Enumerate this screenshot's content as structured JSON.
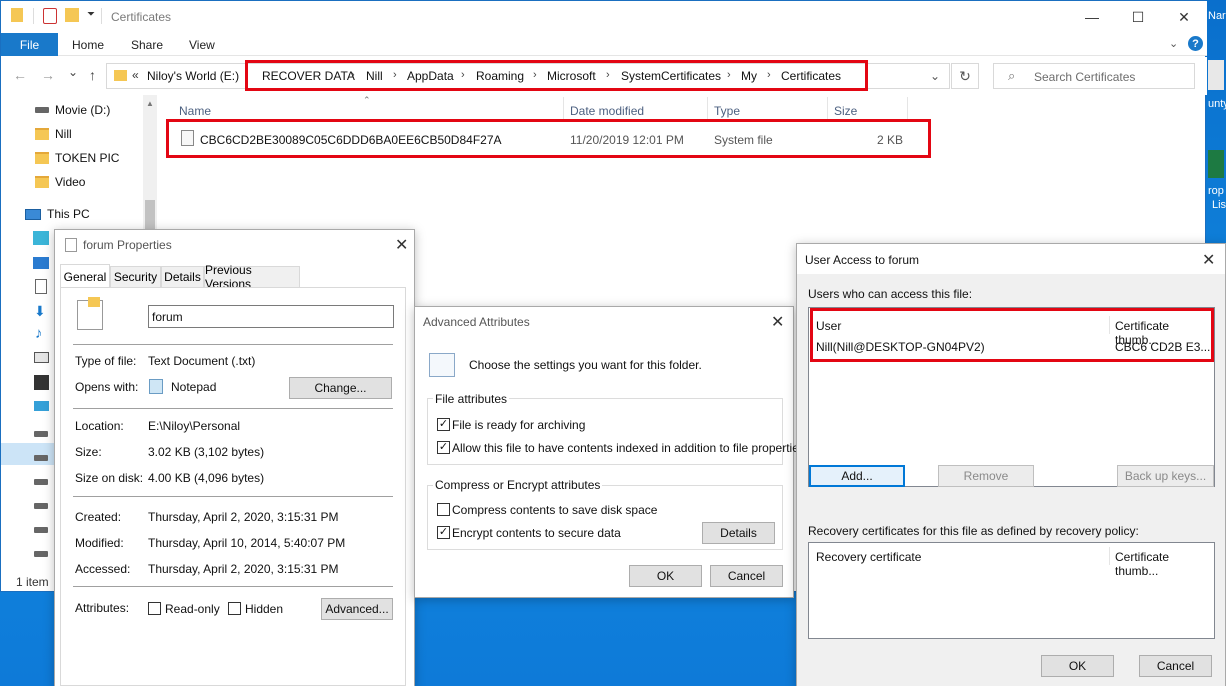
{
  "window": {
    "title": "Certificates",
    "minimize": "—",
    "maximize": "☐",
    "close": "✕"
  },
  "ribbon": {
    "tabs": [
      "File",
      "Home",
      "Share",
      "View"
    ],
    "help": "?"
  },
  "nav": {
    "back": "←",
    "forward": "→",
    "dropdown": "⌄",
    "up": "↑"
  },
  "address": {
    "overflow": "«",
    "crumbs": [
      "Niloy's World (E:)",
      "RECOVER DATA",
      "Nill",
      "AppData",
      "Roaming",
      "Microsoft",
      "SystemCertificates",
      "My",
      "Certificates"
    ],
    "sep": "›"
  },
  "search": {
    "placeholder": "Search Certificates"
  },
  "sidebar": {
    "items": [
      "Movie (D:)",
      "Nill",
      "TOKEN PIC",
      "Video",
      "This PC"
    ]
  },
  "files": {
    "columns": [
      "Name",
      "Date modified",
      "Type",
      "Size"
    ],
    "rows": [
      {
        "name": "CBC6CD2BE30089C05C6DDD6BA0EE6CB50D84F27A",
        "date": "11/20/2019 12:01 PM",
        "type": "System file",
        "size": "2 KB"
      }
    ]
  },
  "status": "1 item",
  "properties": {
    "title": "forum Properties",
    "tabs": [
      "General",
      "Security",
      "Details",
      "Previous Versions"
    ],
    "filename": "forum",
    "type_label": "Type of file:",
    "type_value": "Text Document (.txt)",
    "opens_label": "Opens with:",
    "opens_value": "Notepad",
    "change_btn": "Change...",
    "location_label": "Location:",
    "location_value": "E:\\Niloy\\Personal",
    "size_label": "Size:",
    "size_value": "3.02 KB (3,102 bytes)",
    "disk_label": "Size on disk:",
    "disk_value": "4.00 KB (4,096 bytes)",
    "created_label": "Created:",
    "created_value": "Thursday, April 2, 2020, 3:15:31 PM",
    "modified_label": "Modified:",
    "modified_value": "Thursday, April 10, 2014, 5:40:07 PM",
    "accessed_label": "Accessed:",
    "accessed_value": "Thursday, April 2, 2020, 3:15:31 PM",
    "attributes_label": "Attributes:",
    "readonly": "Read-only",
    "hidden": "Hidden",
    "advanced_btn": "Advanced..."
  },
  "advanced": {
    "title": "Advanced Attributes",
    "intro": "Choose the settings you want for this folder.",
    "file_attr_heading": "File attributes",
    "archive": "File is ready for archiving",
    "index": "Allow this file to have contents indexed in addition to file properties",
    "compress_heading": "Compress or Encrypt attributes",
    "compress": "Compress contents to save disk space",
    "encrypt": "Encrypt contents to secure data",
    "details_btn": "Details",
    "ok": "OK",
    "cancel": "Cancel",
    "check": "✓"
  },
  "user_access": {
    "title": "User Access to forum",
    "users_label": "Users who can access this file:",
    "col_user": "User",
    "col_thumb": "Certificate thumb...",
    "user_value": "Nill(Nill@DESKTOP-GN04PV2)",
    "thumb_value": "CBC6 CD2B E3...",
    "add_btn": "Add...",
    "remove_btn": "Remove",
    "backup_btn": "Back up keys...",
    "recovery_label": "Recovery certificates for this file as defined by recovery policy:",
    "col_recovery": "Recovery certificate",
    "col_rthumb": "Certificate thumb...",
    "ok": "OK",
    "cancel": "Cancel"
  },
  "desktop_right": {
    "lines": [
      "Nar",
      "unty",
      "rop",
      "Lis"
    ]
  }
}
